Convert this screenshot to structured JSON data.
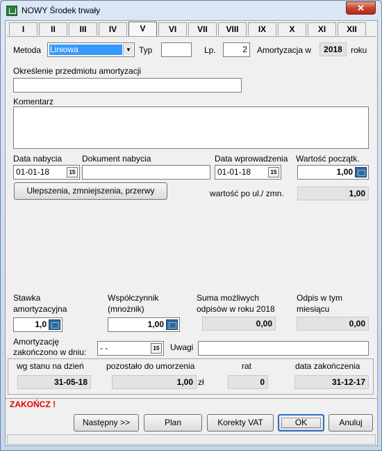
{
  "window": {
    "title": "NOWY Środek trwały",
    "close_label": "✕"
  },
  "tabs": [
    "I",
    "II",
    "III",
    "IV",
    "V",
    "VI",
    "VII",
    "VIII",
    "IX",
    "X",
    "XI",
    "XII"
  ],
  "active_tab": "V",
  "metoda": {
    "label": "Metoda",
    "value": "Liniowa"
  },
  "typ": {
    "label": "Typ",
    "value": ""
  },
  "lp": {
    "label": "Lp.",
    "value": "2"
  },
  "amortyzacja": {
    "label_pre": "Amortyzacja w",
    "year": "2018",
    "label_post": "roku"
  },
  "okreslenie": {
    "label": "Określenie przedmiotu amortyzacji",
    "value": ""
  },
  "komentarz": {
    "label": "Komentarz",
    "value": ""
  },
  "data_nabycia": {
    "label": "Data nabycia",
    "value": "01-01-18"
  },
  "dokument_nabycia": {
    "label": "Dokument nabycia",
    "value": ""
  },
  "data_wprowadzenia": {
    "label": "Data wprowadzenia",
    "value": "01-01-18"
  },
  "wartosc_poczatkowa": {
    "label": "Wartość początk.",
    "value": "1,00"
  },
  "ulepszenia_button": "Ulepszenia, zmniejszenia, przerwy",
  "wartosc_po_ul": {
    "label": "wartość po ul./ zmn.",
    "value": "1,00"
  },
  "stawka": {
    "label_1": "Stawka",
    "label_2": "amortyzacyjna",
    "value": "1,0"
  },
  "wspolczynnik": {
    "label_1": "Współczynnik",
    "label_2": "(mnożnik)",
    "value": "1,00"
  },
  "suma_odpisow": {
    "label_1": "Suma możliwych",
    "label_2": "odpisów w roku 2018",
    "value": "0,00"
  },
  "odpis_miesiac": {
    "label_1": "Odpis w tym",
    "label_2": "miesiącu",
    "value": "0,00"
  },
  "amortyzacje_zakonczono": {
    "label_1": "Amortyzację",
    "label_2": "zakończono w dniu:",
    "value": "-  -"
  },
  "uwagi": {
    "label": "Uwagi",
    "value": ""
  },
  "summary": {
    "wg_stanu_label": "wg stanu na dzień",
    "wg_stanu_value": "31-05-18",
    "pozostalo_label": "pozostało do umorzenia",
    "pozostalo_value": "1,00",
    "pozostalo_unit": "zł",
    "rat_label": "rat",
    "rat_value": "0",
    "data_zakonczenia_label": "data zakończenia",
    "data_zakonczenia_value": "31-12-17"
  },
  "zakoncz_label": "ZAKOŃCZ !",
  "buttons": {
    "nastepny": "Następny >>",
    "plan": "Plan",
    "korekty": "Korekty VAT",
    "ok": "OK",
    "anuluj": "Anuluj"
  },
  "colors": {
    "zakoncz": "#e00000",
    "selection": "#3399ff"
  }
}
